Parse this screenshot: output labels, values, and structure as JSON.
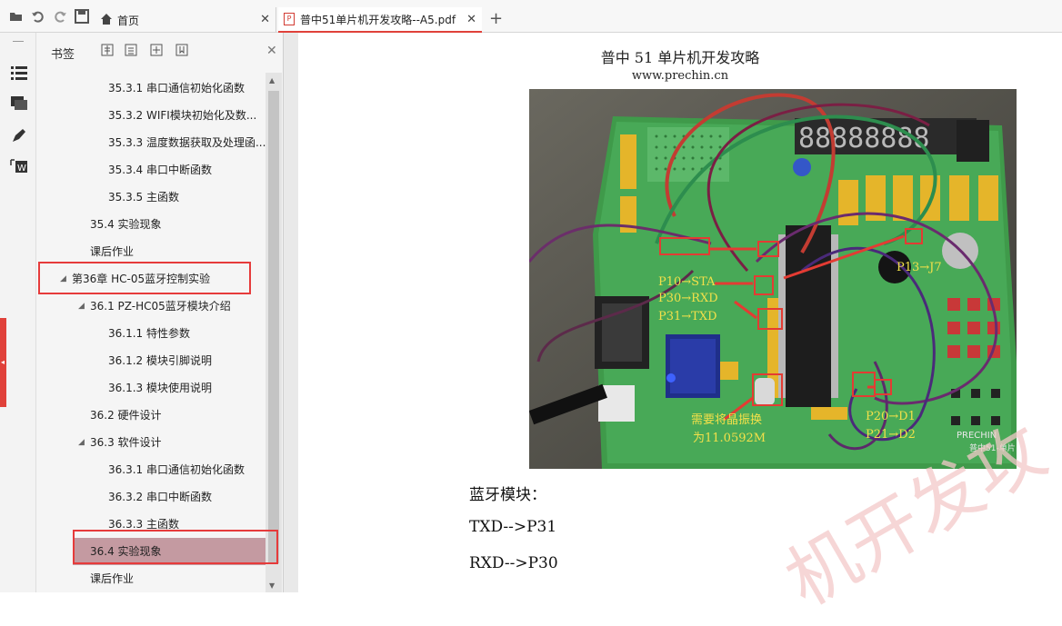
{
  "toolbar": {
    "icons": [
      "open-icon",
      "undo-icon",
      "redo-icon",
      "save-icon"
    ]
  },
  "tabs": [
    {
      "label": "首页",
      "icon": "home-icon",
      "active": false
    },
    {
      "label": "普中51单片机开发攻略--A5.pdf",
      "icon": "pdf-icon",
      "active": true
    }
  ],
  "add_tab_label": "+",
  "bookmarks_panel": {
    "title": "书签",
    "items": [
      {
        "label": "35.3.1 串口通信初始化函数",
        "level": 3
      },
      {
        "label": "35.3.2 WIFI模块初始化及数...",
        "level": 3
      },
      {
        "label": "35.3.3 温度数据获取及处理函...",
        "level": 3
      },
      {
        "label": "35.3.4 串口中断函数",
        "level": 3
      },
      {
        "label": "35.3.5 主函数",
        "level": 3
      },
      {
        "label": "35.4 实验现象",
        "level": 2
      },
      {
        "label": "课后作业",
        "level": 2
      },
      {
        "label": "第36章 HC-05蓝牙控制实验",
        "level": 1,
        "expanded": true,
        "highlighted": true
      },
      {
        "label": "36.1 PZ-HC05蓝牙模块介绍",
        "level": 2,
        "expanded": true
      },
      {
        "label": "36.1.1 特性参数",
        "level": 3
      },
      {
        "label": "36.1.2 模块引脚说明",
        "level": 3
      },
      {
        "label": "36.1.3 模块使用说明",
        "level": 3
      },
      {
        "label": "36.2 硬件设计",
        "level": 2
      },
      {
        "label": "36.3 软件设计",
        "level": 2,
        "expanded": true
      },
      {
        "label": "36.3.1 串口通信初始化函数",
        "level": 3
      },
      {
        "label": "36.3.2 串口中断函数",
        "level": 3
      },
      {
        "label": "36.3.3 主函数",
        "level": 3
      },
      {
        "label": "36.4 实验现象",
        "level": 2,
        "selected": true,
        "highlighted": true
      },
      {
        "label": "课后作业",
        "level": 2
      }
    ]
  },
  "document": {
    "header_title": "普中 51 单片机开发攻略",
    "header_url": "www.prechin.cn",
    "photo_labels": {
      "p10": "P10→STA",
      "p30": "P30→RXD",
      "p31": "P31→TXD",
      "p13": "P13→J7",
      "crystal_line1": "需要将晶振换",
      "crystal_line2": "为11.0592M",
      "p20": "P20→D1",
      "p21": "P21→D2",
      "board_brand": "PRECHIN",
      "board_model": "普中51-单片"
    },
    "body_lines": [
      "蓝牙模块：",
      "TXD-->P31",
      "RXD-->P30"
    ],
    "watermark": "机开发攻"
  },
  "colors": {
    "accent": "#e0413a",
    "highlight_box": "#e63b3b",
    "selected_bg": "#c49aa1",
    "photo_label": "#f2e04a"
  }
}
